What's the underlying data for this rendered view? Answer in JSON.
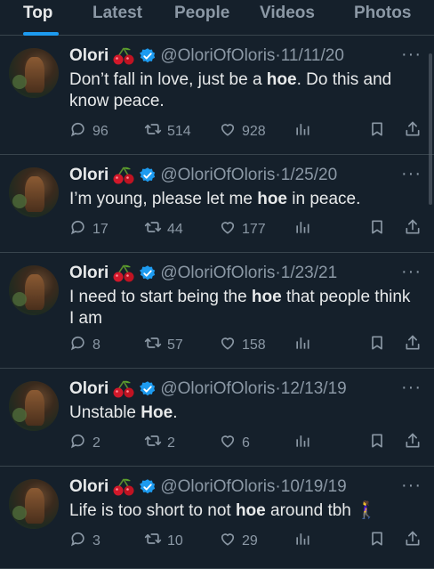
{
  "tabs": [
    "Top",
    "Latest",
    "People",
    "Videos",
    "Photos"
  ],
  "active_tab": "Top",
  "tweets": [
    {
      "name": "Olori",
      "handle": "@OloriOfOloris",
      "date": "11/11/20",
      "text_before": "Don’t fall in love, just be a ",
      "text_bold": "hoe",
      "text_after": ". Do this and know peace.",
      "replies": "96",
      "retweets": "514",
      "likes": "928"
    },
    {
      "name": "Olori",
      "handle": "@OloriOfOloris",
      "date": "1/25/20",
      "text_before": "I’m young, please let me ",
      "text_bold": "hoe",
      "text_after": " in peace.",
      "replies": "17",
      "retweets": "44",
      "likes": "177"
    },
    {
      "name": "Olori",
      "handle": "@OloriOfOloris",
      "date": "1/23/21",
      "text_before": "I need to start being the ",
      "text_bold": "hoe",
      "text_after": " that people think I am",
      "replies": "8",
      "retweets": "57",
      "likes": "158"
    },
    {
      "name": "Olori",
      "handle": "@OloriOfOloris",
      "date": "12/13/19",
      "text_before": "Unstable ",
      "text_bold": "Hoe",
      "text_after": ".",
      "replies": "2",
      "retweets": "2",
      "likes": "6"
    },
    {
      "name": "Olori",
      "handle": "@OloriOfOloris",
      "date": "10/19/19",
      "text_before": "Life is too short to not ",
      "text_bold": "hoe",
      "text_after": " around tbh 🚶‍♀️",
      "replies": "3",
      "retweets": "10",
      "likes": "29"
    }
  ],
  "colors": {
    "background": "#15202b",
    "accent": "#1d9bf0",
    "muted": "#8b98a5",
    "text": "#e7e9ea"
  },
  "icons": [
    "reply-icon",
    "retweet-icon",
    "like-icon",
    "views-icon",
    "bookmark-icon",
    "share-icon",
    "verified-icon",
    "cherry-emoji",
    "more-icon"
  ]
}
